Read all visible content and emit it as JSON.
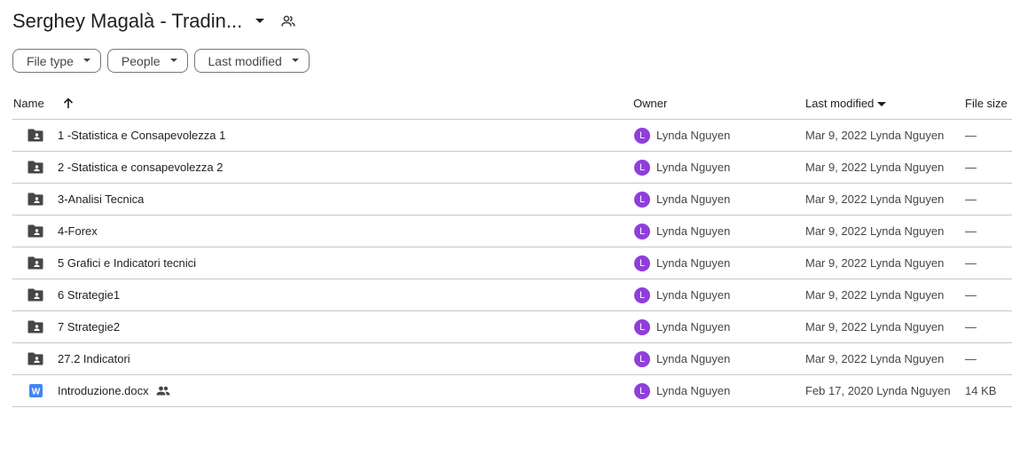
{
  "header": {
    "title": "Serghey Magalà - Tradin...",
    "caret_icon": "arrow-drop-down-icon",
    "shared_icon": "people-outline-icon"
  },
  "filters": [
    {
      "label": "File type"
    },
    {
      "label": "People"
    },
    {
      "label": "Last modified"
    }
  ],
  "columns": {
    "name": "Name",
    "owner": "Owner",
    "last_modified": "Last modified",
    "file_size": "File size"
  },
  "colors": {
    "avatar": "#8f3fd9",
    "folder": "#444746",
    "word": "#4285f4",
    "divider": "#c7c7c7"
  },
  "rows": [
    {
      "type": "folder",
      "name": "1 -Statistica e Consapevolezza 1",
      "owner": "Lynda Nguyen",
      "owner_initial": "L",
      "modified": "Mar 9, 2022 Lynda Nguyen",
      "size": "—",
      "shared": false
    },
    {
      "type": "folder",
      "name": "2 -Statistica e consapevolezza 2",
      "owner": "Lynda Nguyen",
      "owner_initial": "L",
      "modified": "Mar 9, 2022 Lynda Nguyen",
      "size": "—",
      "shared": false
    },
    {
      "type": "folder",
      "name": "3-Analisi Tecnica",
      "owner": "Lynda Nguyen",
      "owner_initial": "L",
      "modified": "Mar 9, 2022 Lynda Nguyen",
      "size": "—",
      "shared": false
    },
    {
      "type": "folder",
      "name": "4-Forex",
      "owner": "Lynda Nguyen",
      "owner_initial": "L",
      "modified": "Mar 9, 2022 Lynda Nguyen",
      "size": "—",
      "shared": false
    },
    {
      "type": "folder",
      "name": "5 Grafici e Indicatori tecnici",
      "owner": "Lynda Nguyen",
      "owner_initial": "L",
      "modified": "Mar 9, 2022 Lynda Nguyen",
      "size": "—",
      "shared": false
    },
    {
      "type": "folder",
      "name": "6 Strategie1",
      "owner": "Lynda Nguyen",
      "owner_initial": "L",
      "modified": "Mar 9, 2022 Lynda Nguyen",
      "size": "—",
      "shared": false
    },
    {
      "type": "folder",
      "name": "7 Strategie2",
      "owner": "Lynda Nguyen",
      "owner_initial": "L",
      "modified": "Mar 9, 2022 Lynda Nguyen",
      "size": "—",
      "shared": false
    },
    {
      "type": "folder",
      "name": "27.2 Indicatori",
      "owner": "Lynda Nguyen",
      "owner_initial": "L",
      "modified": "Mar 9, 2022 Lynda Nguyen",
      "size": "—",
      "shared": false
    },
    {
      "type": "docx",
      "name": "Introduzione.docx",
      "owner": "Lynda Nguyen",
      "owner_initial": "L",
      "modified": "Feb 17, 2020 Lynda Nguyen",
      "size": "14 KB",
      "shared": true
    }
  ]
}
